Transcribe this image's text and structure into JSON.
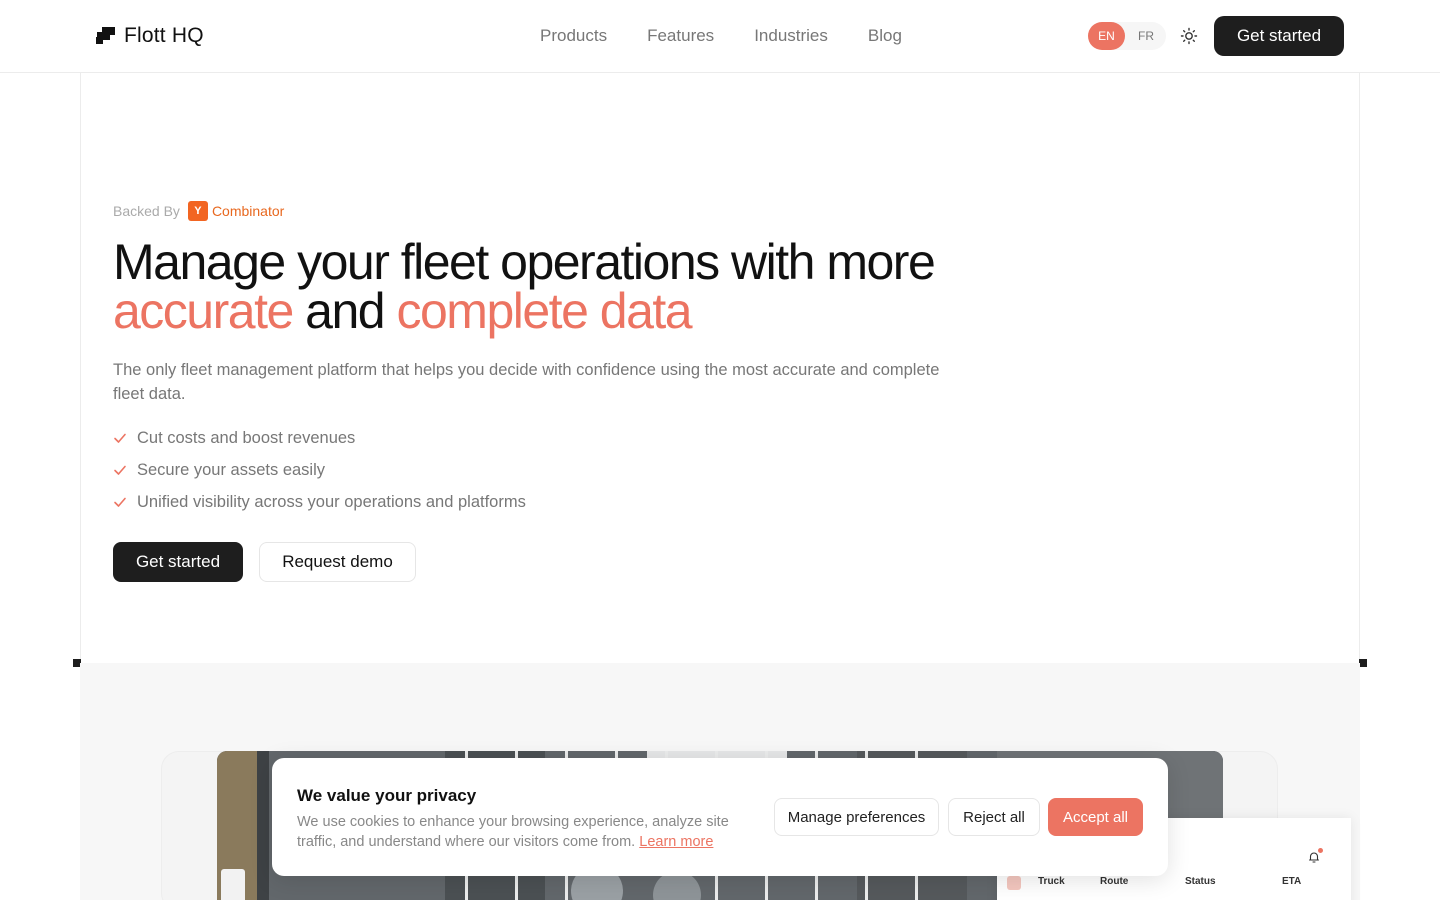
{
  "header": {
    "brand": "Flott HQ",
    "nav": [
      "Products",
      "Features",
      "Industries",
      "Blog"
    ],
    "lang_active": "EN",
    "lang_other": "FR",
    "cta": "Get started"
  },
  "hero": {
    "backed_label": "Backed By",
    "yc_letter": "Y",
    "yc_name": "Combinator",
    "headline_line1": "Manage your fleet operations with more",
    "headline_accent1": "accurate",
    "headline_and": " and ",
    "headline_accent2": "complete data",
    "subtitle": "The only fleet management platform that helps you decide with confidence using the most accurate and complete fleet data.",
    "features": [
      "Cut costs and boost revenues",
      "Secure your assets easily",
      "Unified visibility across your operations and platforms"
    ],
    "primary_button": "Get started",
    "secondary_button": "Request demo"
  },
  "dashboard_preview": {
    "columns": [
      "Truck",
      "Route",
      "Status",
      "ETA"
    ]
  },
  "cookie_banner": {
    "title": "We value your privacy",
    "text": "We use cookies to enhance your browsing experience, analyze site traffic, and understand where our visitors come from.",
    "link": "Learn more",
    "manage_button": "Manage preferences",
    "reject_button": "Reject all",
    "accept_button": "Accept all"
  },
  "colors": {
    "accent": "#ec7462",
    "dark": "#1e1e1e",
    "yc_orange": "#f26522"
  },
  "icons": {
    "logo": "flott-logo-icon",
    "theme": "sun-icon",
    "check": "check-icon",
    "bell": "bell-icon"
  }
}
